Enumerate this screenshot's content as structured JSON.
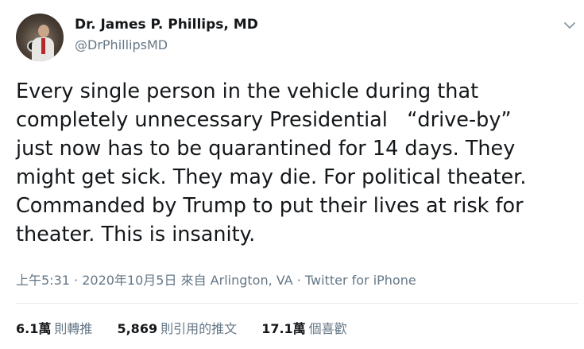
{
  "author": {
    "name": "Dr. James P. Phillips, MD",
    "handle": "@DrPhillipsMD",
    "avatar_icon": "profile-photo"
  },
  "tweet": {
    "lines": [
      "Every single person in the vehicle during that",
      "completely unnecessary Presidential   “drive-by”",
      "just now has to be quarantined for 14 days. They",
      "might get sick. They may die. For political theater.",
      "Commanded by Trump to put their lives at risk for",
      "theater. This is insanity."
    ]
  },
  "meta": {
    "time": "上午5:31",
    "date": "2020年10月5日",
    "from_label": "來自",
    "location": "Arlington, VA",
    "source": "Twitter for iPhone"
  },
  "stats": {
    "retweets": {
      "count": "6.1萬",
      "label": "則轉推"
    },
    "quotes": {
      "count": "5,869",
      "label": "則引用的推文"
    },
    "likes": {
      "count": "17.1萬",
      "label": "個喜歡"
    }
  },
  "icons": {
    "menu": "chevron-down-icon"
  },
  "colors": {
    "text": "#14171a",
    "secondary": "#657786",
    "divider": "#e6ecf0"
  }
}
